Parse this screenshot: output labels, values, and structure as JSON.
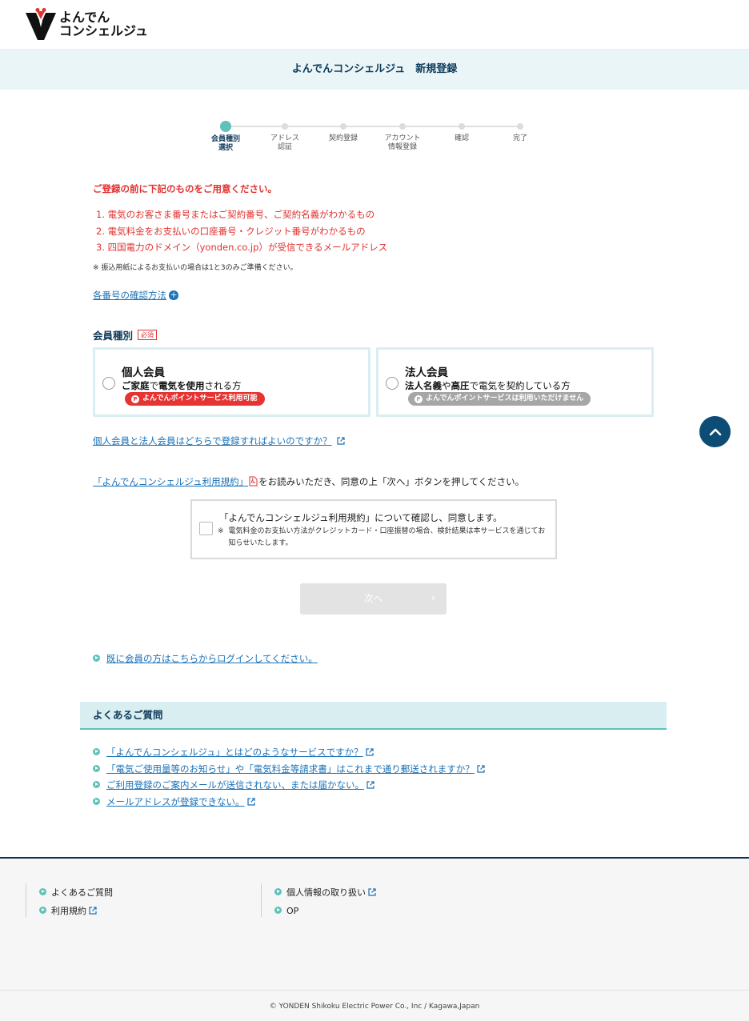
{
  "header": {
    "logo_line1": "よんでん",
    "logo_line2": "コンシェルジュ"
  },
  "page_title": "よんでんコンシェルジュ　新規登録",
  "steps": [
    {
      "label_line1": "会員種別",
      "label_line2": "選択",
      "active": true
    },
    {
      "label_line1": "アドレス",
      "label_line2": "認証",
      "active": false
    },
    {
      "label_line1": "契約登録",
      "label_line2": "",
      "active": false
    },
    {
      "label_line1": "アカウント",
      "label_line2": "情報登録",
      "active": false
    },
    {
      "label_line1": "確認",
      "label_line2": "",
      "active": false
    },
    {
      "label_line1": "完了",
      "label_line2": "",
      "active": false
    }
  ],
  "preparation": {
    "title": "ご登録の前に下記のものをご用意ください。",
    "items": [
      "1. 電気のお客さま番号またはご契約番号、ご契約名義がわかるもの",
      "2. 電気料金をお支払いの口座番号・クレジット番号がわかるもの",
      "3. 四国電力のドメイン（yonden.co.jp）が受信できるメールアドレス"
    ],
    "note": "※ 振込用紙によるお支払いの場合は1と3のみご準備ください。",
    "confirm_link": "各番号の確認方法"
  },
  "member_type": {
    "label": "会員種別",
    "required": "必須",
    "options": [
      {
        "title": "個人会員",
        "desc_bold1": "ご家庭",
        "desc_mid": "で",
        "desc_bold2": "電気を使用",
        "desc_tail": "される方",
        "badge": "よんでんポイントサービス利用可能",
        "badge_icon": "P"
      },
      {
        "title": "法人会員",
        "desc_bold1": "法人名義",
        "desc_mid": "や",
        "desc_bold2": "高圧",
        "desc_tail": "で電気を契約している方",
        "badge": "よんでんポイントサービスは利用いただけません",
        "badge_icon": "P"
      }
    ],
    "which_link": "個人会員と法人会員はどちらで登録すればよいのですか？"
  },
  "terms": {
    "link": "「よんでんコンシェルジュ利用規約」",
    "after_link": "をお読みいただき、同意の上「次へ」ボタンを押してください。",
    "agree_text": "「よんでんコンシェルジュ利用規約」について確認し、同意します。",
    "agree_note_mark": "※",
    "agree_note": "電気料金のお支払い方法がクレジットカード・口座振替の場合、検針結果は本サービスを通じてお知らせいたします。"
  },
  "next_button": "次へ",
  "login_link": "既に会員の方はこちらからログインしてください。",
  "faq": {
    "title": "よくあるご質問",
    "items": [
      "「よんでんコンシェルジュ」とはどのようなサービスですか？",
      "「電気ご使用量等のお知らせ」や「電気料金等請求書」はこれまで通り郵送されますか？",
      "ご利用登録のご案内メールが送信されない、または届かない。",
      "メールアドレスが登録できない。"
    ]
  },
  "footer": {
    "col1": [
      "よくあるご質問",
      "利用規約"
    ],
    "col2": [
      "個人情報の取り扱い",
      "OP"
    ],
    "copyright": "© YONDEN Shikoku Electric Power Co., Inc / Kagawa,Japan"
  },
  "colors": {
    "accent_teal": "#5fc2b8",
    "navy": "#0e3a5a",
    "alert_red": "#e0322f",
    "link_blue": "#1a72b8"
  }
}
